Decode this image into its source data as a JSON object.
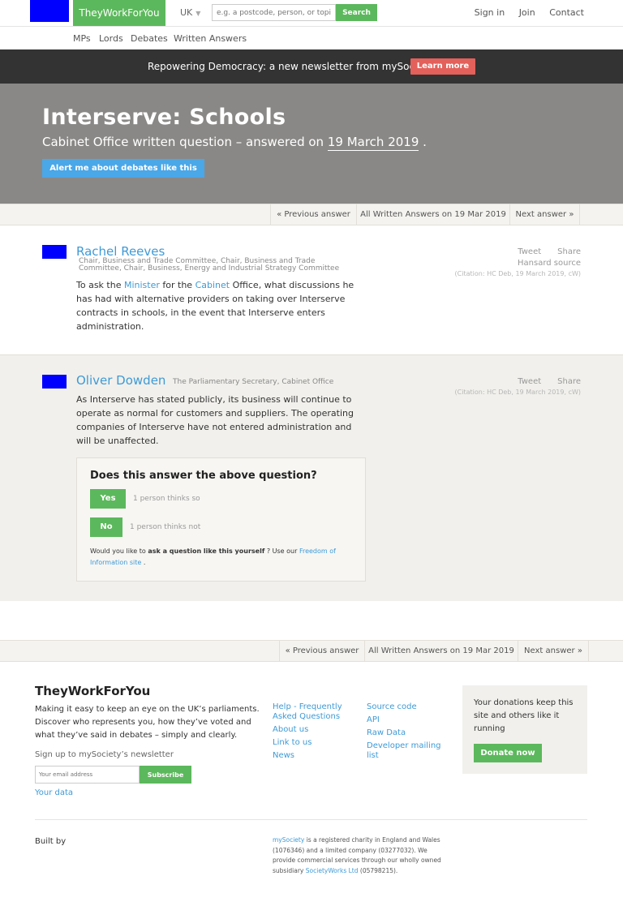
{
  "header": {
    "brand": "TheyWorkForYou",
    "country": "UK",
    "search_placeholder": "e.g. a postcode, person, or topic",
    "search_button": "Search",
    "links": [
      "Sign in",
      "Join",
      "Contact"
    ]
  },
  "subnav": [
    "MPs",
    "Lords",
    "Debates",
    "Written Answers"
  ],
  "banner": {
    "text": "Repowering Democracy: a new newsletter from mySociety",
    "button": "Learn more"
  },
  "hero": {
    "title": "Interserve: Schools",
    "subtitle_prefix": "Cabinet Office written question – answered on",
    "date": "19 March 2019",
    "subtitle_suffix": ".",
    "alert_button": "Alert me about debates like this"
  },
  "answer_nav": {
    "previous": "« Previous answer",
    "all": "All Written Answers on 19 Mar 2019",
    "next": "Next answer »"
  },
  "question": {
    "speaker": "Rachel Reeves",
    "role": "Chair, Business and Trade Committee, Chair, Business and Trade Committee, Chair, Business, Energy and Industrial Strategy Committee",
    "tweet": "Tweet",
    "share": "Share",
    "hansard": "Hansard source",
    "citation": "(Citation: HC Deb, 19 March 2019, cW)",
    "text_1": "To ask the",
    "link_1": "Minister",
    "text_2": "for the",
    "link_2": "Cabinet",
    "text_3": "Office, what discussions he has had with alternative providers on taking over Interserve contracts in schools, in the event that Interserve enters administration."
  },
  "answer": {
    "speaker": "Oliver Dowden",
    "role": "The Parliamentary Secretary, Cabinet Office",
    "tweet": "Tweet",
    "share": "Share",
    "citation": "(Citation: HC Deb, 19 March 2019, cW)",
    "text": "As Interserve has stated publicly, its business will continue to operate as normal for customers and suppliers. The operating companies of Interserve have not entered administration and will be unaffected."
  },
  "vote": {
    "question": "Does this answer the above question?",
    "yes": "Yes",
    "yes_count": "1 person thinks so",
    "no": "No",
    "no_count": "1 person thinks not",
    "ask_prefix": "Would you like to",
    "ask_bold": "ask a question like this yourself",
    "ask_mid": "? Use our",
    "ask_link": "Freedom of Information site",
    "ask_suffix": "."
  },
  "footer": {
    "title": "TheyWorkForYou",
    "description": "Making it easy to keep an eye on the UK’s parliaments. Discover who represents you, how they’ve voted and what they’ve said in debates – simply and clearly.",
    "newsletter_label": "Sign up to mySociety’s newsletter",
    "email_placeholder": "Your email address",
    "subscribe": "Subscribe",
    "your_data": "Your data",
    "col1": [
      "Help - Frequently Asked Questions",
      "About us",
      "Link to us",
      "News"
    ],
    "col2": [
      "Source code",
      "API",
      "Raw Data",
      "Developer mailing list"
    ],
    "donate_text": "Your donations keep this site and others like it running",
    "donate_button": "Donate now",
    "built_by": "Built by",
    "legal_link1": "mySociety",
    "legal_text1": "is a registered charity in England and Wales (1076346) and a limited company (03277032). We provide commercial services through our wholly owned subsidiary",
    "legal_link2": "SocietyWorks Ltd",
    "legal_text2": "(05798215)."
  },
  "colors": {
    "brand_green": "#5cb85c",
    "link_blue": "#3e9ad6",
    "banner_dark": "#333333",
    "banner_button": "#e3605b",
    "hero_grey": "#8a8886"
  }
}
